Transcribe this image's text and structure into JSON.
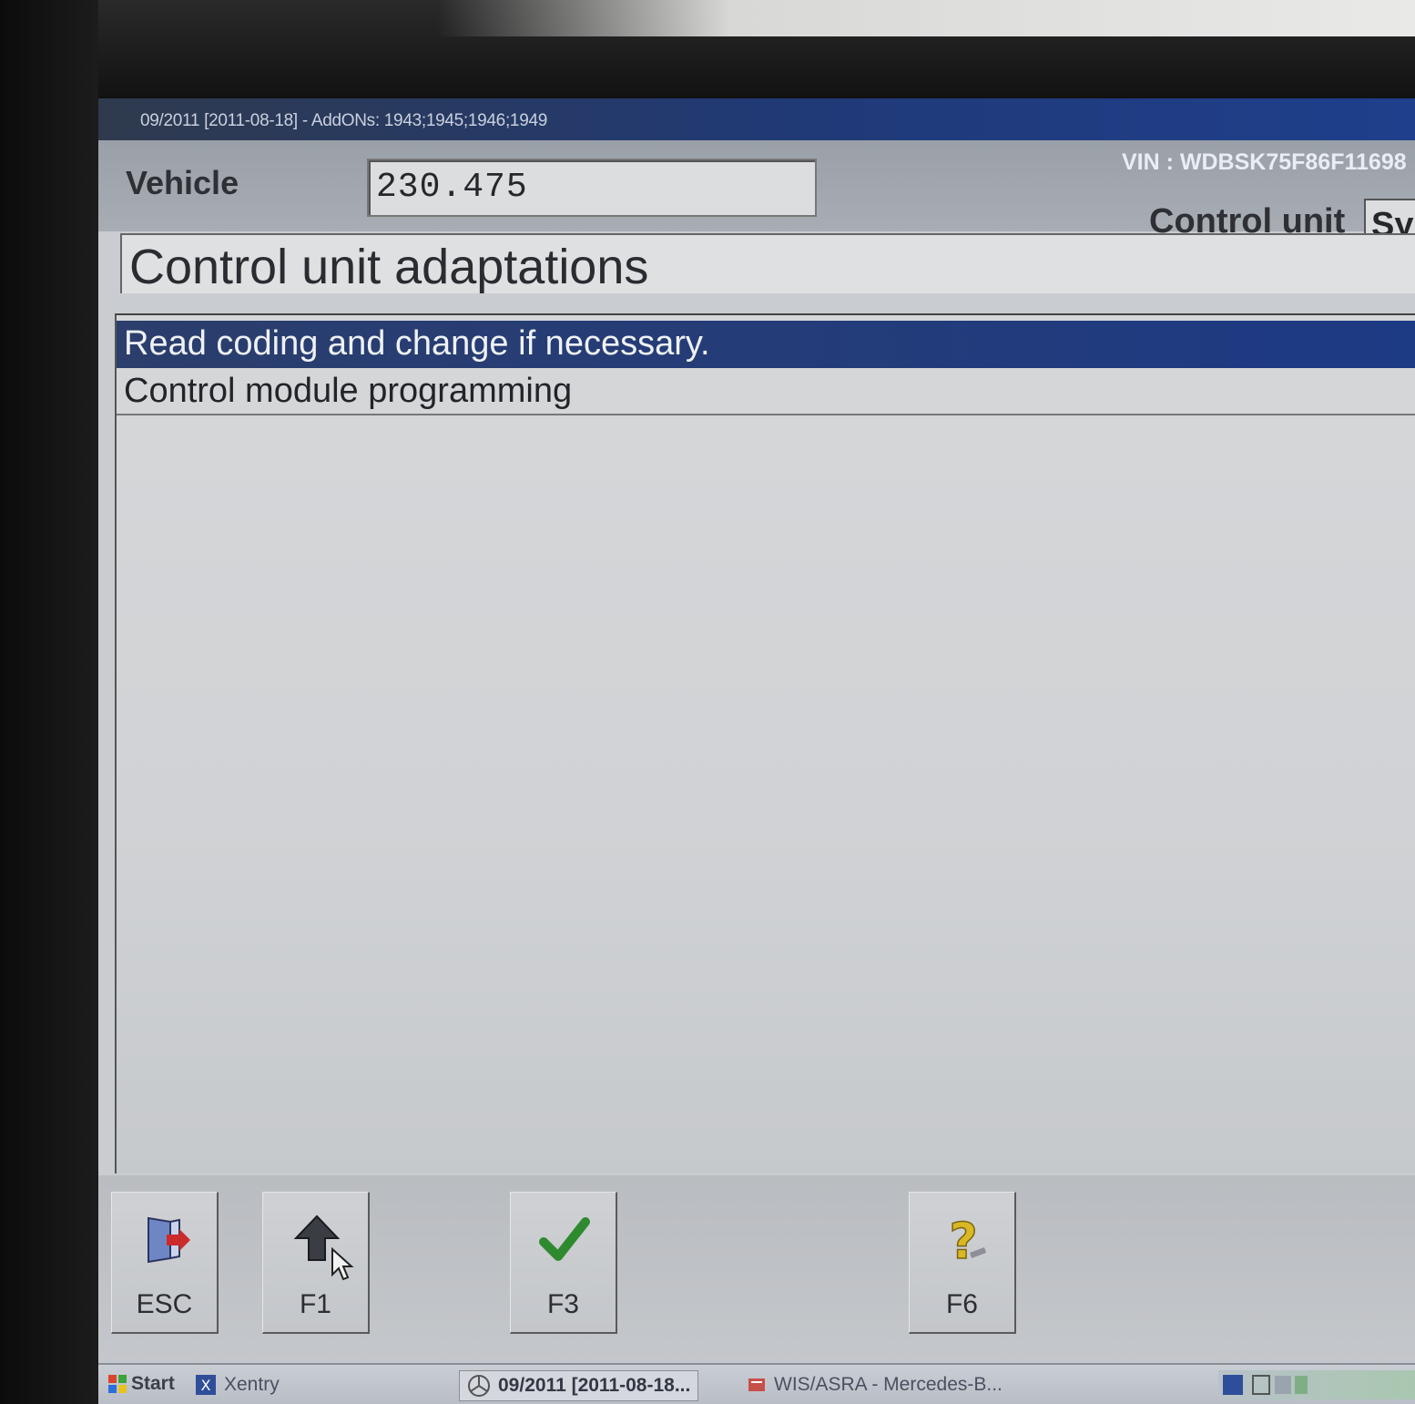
{
  "window": {
    "title": "09/2011 [2011-08-18] - AddONs: 1943;1945;1946;1949"
  },
  "header": {
    "vehicle_label": "Vehicle",
    "vehicle_value": "230.475",
    "vin": "VIN : WDBSK75F86F11698",
    "control_unit_label": "Control unit",
    "control_unit_value": "Sy"
  },
  "page": {
    "title": "Control unit adaptations"
  },
  "menu": {
    "items": [
      {
        "label": "Read coding and change if necessary.",
        "selected": true
      },
      {
        "label": "Control module programming",
        "selected": false
      }
    ]
  },
  "fkeys": [
    {
      "label": "ESC",
      "icon": "exit-door-icon"
    },
    {
      "label": "F1",
      "icon": "up-arrow-icon"
    },
    {
      "label": "F3",
      "icon": "checkmark-icon"
    },
    {
      "label": "F6",
      "icon": "help-question-icon"
    }
  ],
  "taskbar": {
    "start_label": "Start",
    "items": [
      {
        "label": "Xentry"
      },
      {
        "label": "09/2011 [2011-08-18..."
      },
      {
        "label": "WIS/ASRA - Mercedes-B..."
      }
    ]
  },
  "colors": {
    "titlebar": "#1f3f8c",
    "selection": "#1d3a84",
    "check_green": "#2f8a2f",
    "help_yellow": "#d9b824"
  }
}
